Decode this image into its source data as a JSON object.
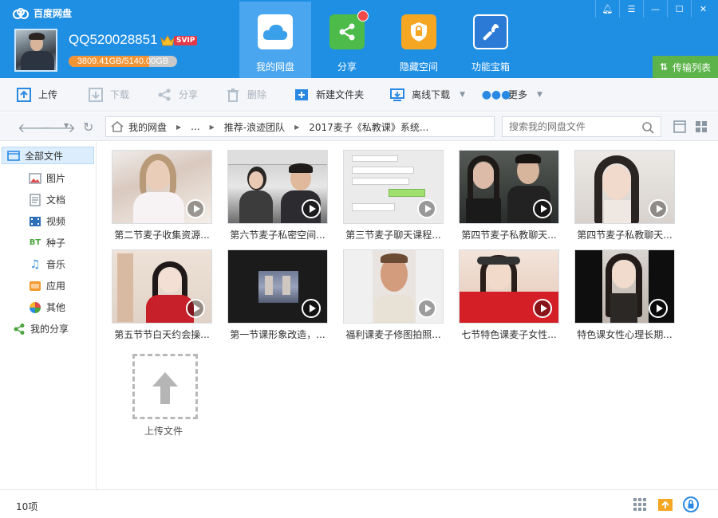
{
  "app": {
    "title": "百度网盘"
  },
  "user": {
    "name": "QQ520028851",
    "vip_label": "SVIP",
    "quota_text": "3809.41GB/5140.00GB",
    "quota_fraction": 0.741
  },
  "nav": [
    {
      "label": "我的网盘",
      "icon": "cloud-icon",
      "active": true
    },
    {
      "label": "分享",
      "icon": "share-icon",
      "badge": true
    },
    {
      "label": "隐藏空间",
      "icon": "lock-icon"
    },
    {
      "label": "功能宝箱",
      "icon": "wrench-icon"
    }
  ],
  "transfer": {
    "label": "传输列表"
  },
  "toolbar": {
    "upload": "上传",
    "download": "下载",
    "share": "分享",
    "delete": "删除",
    "new_folder": "新建文件夹",
    "offline_download": "离线下载",
    "more": "更多"
  },
  "breadcrumb": {
    "root": "我的网盘",
    "ellipsis": "...",
    "level1": "推荐-浪迹团队",
    "level2": "2017麦子《私教课》系统..."
  },
  "search": {
    "placeholder": "搜索我的网盘文件"
  },
  "sidebar": {
    "all_files": "全部文件",
    "items": [
      {
        "label": "图片",
        "icon": "image-icon"
      },
      {
        "label": "文档",
        "icon": "document-icon"
      },
      {
        "label": "视频",
        "icon": "video-icon"
      },
      {
        "label": "种子",
        "icon": "bt-icon"
      },
      {
        "label": "音乐",
        "icon": "music-icon"
      },
      {
        "label": "应用",
        "icon": "app-icon"
      },
      {
        "label": "其他",
        "icon": "other-icon"
      }
    ],
    "my_share": "我的分享"
  },
  "files": [
    {
      "name": "第二节麦子收集资源...",
      "icon": "video-file"
    },
    {
      "name": "第六节麦子私密空间...",
      "icon": "video-file"
    },
    {
      "name": "第三节麦子聊天课程...",
      "icon": "video-file"
    },
    {
      "name": "第四节麦子私教聊天...",
      "icon": "video-file"
    },
    {
      "name": "第四节麦子私教聊天...",
      "icon": "video-file"
    },
    {
      "name": "第五节节白天约会操...",
      "icon": "video-file"
    },
    {
      "name": "第一节课形象改造，...",
      "icon": "video-file"
    },
    {
      "name": "福利课麦子修图拍照...",
      "icon": "video-file"
    },
    {
      "name": "七节特色课麦子女性...",
      "icon": "video-file"
    },
    {
      "name": "特色课女性心理长期...",
      "icon": "video-file"
    }
  ],
  "upload_tile": {
    "label": "上传文件"
  },
  "status": {
    "count": "10项"
  },
  "colors": {
    "header": "#1f8fe4",
    "nav_active": "#4aa6ee",
    "transfer": "#5cb34a",
    "svip": "#e4394a"
  }
}
